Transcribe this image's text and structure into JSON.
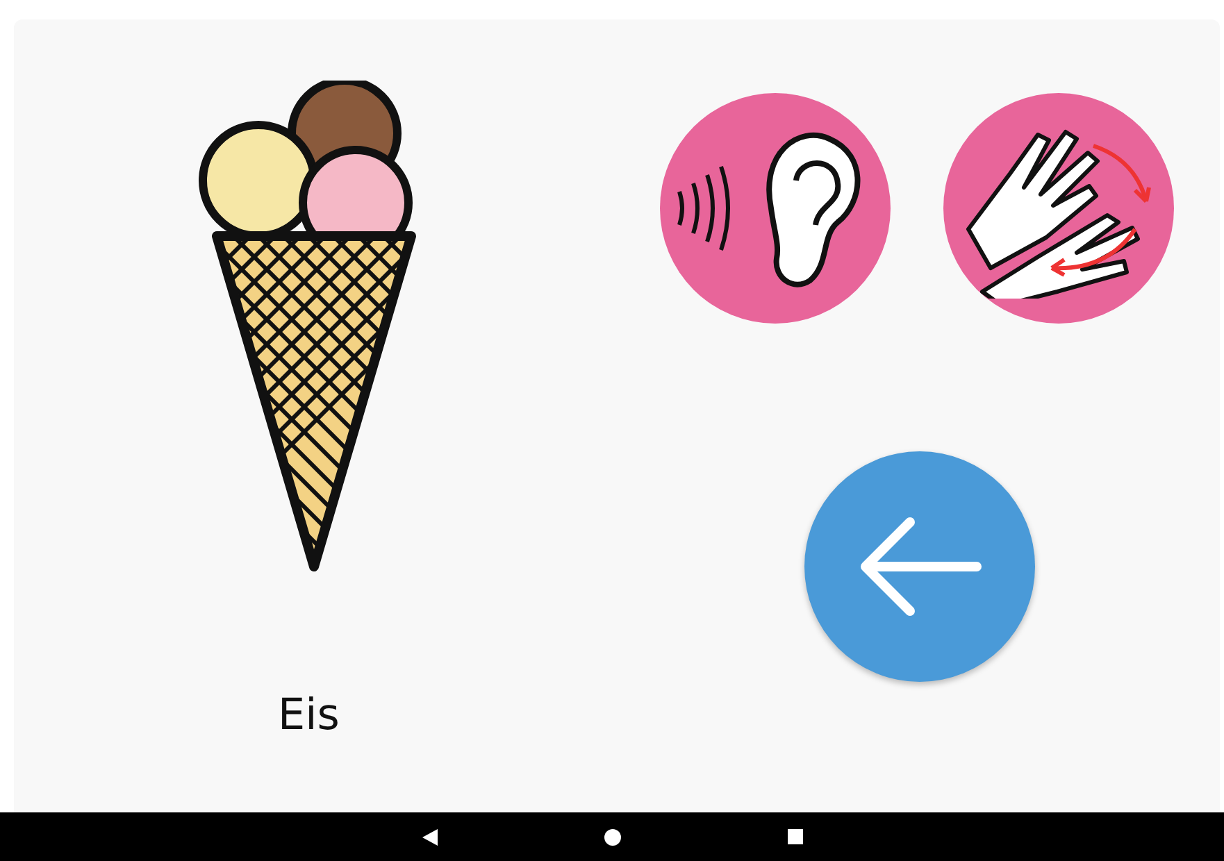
{
  "word": {
    "label": "Eis"
  }
}
